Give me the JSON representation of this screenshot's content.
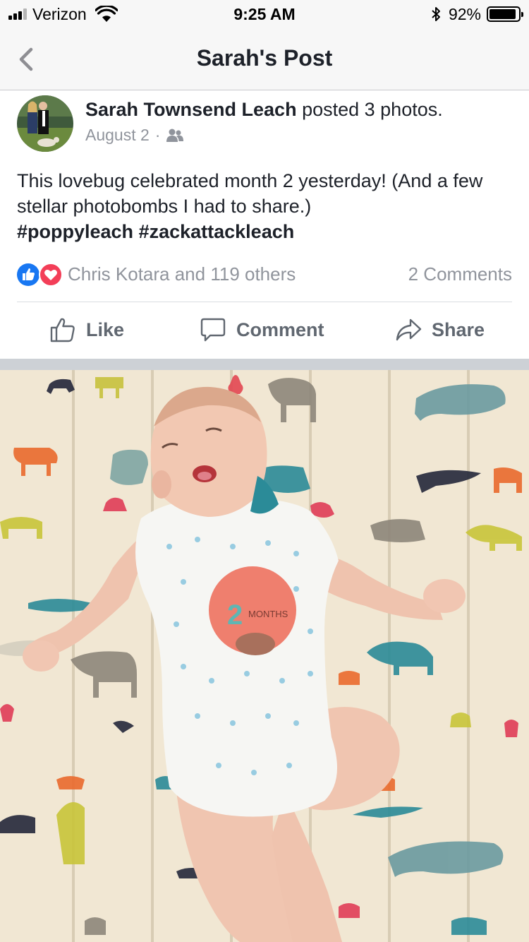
{
  "status_bar": {
    "carrier": "Verizon",
    "time": "9:25 AM",
    "battery_percent": "92%",
    "battery_level": 0.92,
    "signal_bars": 3,
    "signal_bars_total": 4
  },
  "nav": {
    "title": "Sarah's Post",
    "back_icon": "chevron-left-icon"
  },
  "post": {
    "author": "Sarah Townsend Leach",
    "action_text": " posted 3 photos.",
    "date": "August 2",
    "separator": "·",
    "audience_icon": "friends-icon",
    "text": "This lovebug celebrated month 2 yesterday! (And a few stellar photobombs I had to share.)",
    "hashtags": [
      "#poppyleach",
      "#zackattackleach"
    ]
  },
  "reactions": {
    "icons": [
      "like-reaction-icon",
      "love-reaction-icon"
    ],
    "summary": "Chris Kotara and 119 others",
    "comments": "2 Comments"
  },
  "actions": {
    "like": "Like",
    "comment": "Comment",
    "share": "Share"
  },
  "photo": {
    "sticker_number": "2",
    "sticker_label": "MONTHS"
  },
  "colors": {
    "facebook_blue": "#1877f2",
    "love_red": "#f33e58",
    "muted_text": "#90949c",
    "action_text": "#606770",
    "bar_bg": "#f7f7f7"
  }
}
